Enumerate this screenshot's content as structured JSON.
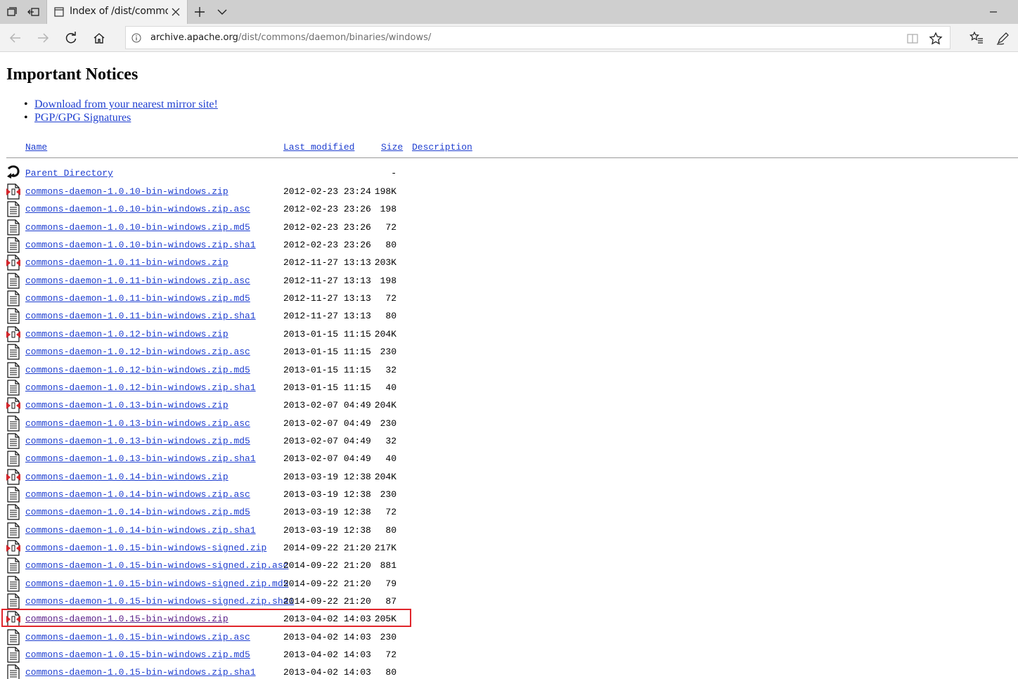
{
  "browser": {
    "tab_title": "Index of /dist/commons",
    "url_host": "archive.apache.org",
    "url_path": "/dist/commons/daemon/binaries/windows/"
  },
  "page": {
    "heading": "Important Notices",
    "notices": [
      {
        "label": "Download from your nearest mirror site!"
      },
      {
        "label": "PGP/GPG Signatures"
      }
    ],
    "columns": {
      "name": "Name",
      "last_modified": "Last modified",
      "size": "Size",
      "description": "Description"
    },
    "parent": {
      "label": "Parent Directory",
      "size": "-"
    },
    "files": [
      {
        "name": "commons-daemon-1.0.10-bin-windows.zip",
        "date": "2012-02-23 23:24",
        "size": "198K",
        "icon": "zip"
      },
      {
        "name": "commons-daemon-1.0.10-bin-windows.zip.asc",
        "date": "2012-02-23 23:26",
        "size": "198",
        "icon": "text"
      },
      {
        "name": "commons-daemon-1.0.10-bin-windows.zip.md5",
        "date": "2012-02-23 23:26",
        "size": "72",
        "icon": "text"
      },
      {
        "name": "commons-daemon-1.0.10-bin-windows.zip.sha1",
        "date": "2012-02-23 23:26",
        "size": "80",
        "icon": "text"
      },
      {
        "name": "commons-daemon-1.0.11-bin-windows.zip",
        "date": "2012-11-27 13:13",
        "size": "203K",
        "icon": "zip"
      },
      {
        "name": "commons-daemon-1.0.11-bin-windows.zip.asc",
        "date": "2012-11-27 13:13",
        "size": "198",
        "icon": "text"
      },
      {
        "name": "commons-daemon-1.0.11-bin-windows.zip.md5",
        "date": "2012-11-27 13:13",
        "size": "72",
        "icon": "text"
      },
      {
        "name": "commons-daemon-1.0.11-bin-windows.zip.sha1",
        "date": "2012-11-27 13:13",
        "size": "80",
        "icon": "text"
      },
      {
        "name": "commons-daemon-1.0.12-bin-windows.zip",
        "date": "2013-01-15 11:15",
        "size": "204K",
        "icon": "zip"
      },
      {
        "name": "commons-daemon-1.0.12-bin-windows.zip.asc",
        "date": "2013-01-15 11:15",
        "size": "230",
        "icon": "text"
      },
      {
        "name": "commons-daemon-1.0.12-bin-windows.zip.md5",
        "date": "2013-01-15 11:15",
        "size": "32",
        "icon": "text"
      },
      {
        "name": "commons-daemon-1.0.12-bin-windows.zip.sha1",
        "date": "2013-01-15 11:15",
        "size": "40",
        "icon": "text"
      },
      {
        "name": "commons-daemon-1.0.13-bin-windows.zip",
        "date": "2013-02-07 04:49",
        "size": "204K",
        "icon": "zip"
      },
      {
        "name": "commons-daemon-1.0.13-bin-windows.zip.asc",
        "date": "2013-02-07 04:49",
        "size": "230",
        "icon": "text"
      },
      {
        "name": "commons-daemon-1.0.13-bin-windows.zip.md5",
        "date": "2013-02-07 04:49",
        "size": "32",
        "icon": "text"
      },
      {
        "name": "commons-daemon-1.0.13-bin-windows.zip.sha1",
        "date": "2013-02-07 04:49",
        "size": "40",
        "icon": "text"
      },
      {
        "name": "commons-daemon-1.0.14-bin-windows.zip",
        "date": "2013-03-19 12:38",
        "size": "204K",
        "icon": "zip"
      },
      {
        "name": "commons-daemon-1.0.14-bin-windows.zip.asc",
        "date": "2013-03-19 12:38",
        "size": "230",
        "icon": "text"
      },
      {
        "name": "commons-daemon-1.0.14-bin-windows.zip.md5",
        "date": "2013-03-19 12:38",
        "size": "72",
        "icon": "text"
      },
      {
        "name": "commons-daemon-1.0.14-bin-windows.zip.sha1",
        "date": "2013-03-19 12:38",
        "size": "80",
        "icon": "text"
      },
      {
        "name": "commons-daemon-1.0.15-bin-windows-signed.zip",
        "date": "2014-09-22 21:20",
        "size": "217K",
        "icon": "zip"
      },
      {
        "name": "commons-daemon-1.0.15-bin-windows-signed.zip.asc",
        "date": "2014-09-22 21:20",
        "size": "881",
        "icon": "text"
      },
      {
        "name": "commons-daemon-1.0.15-bin-windows-signed.zip.md5",
        "date": "2014-09-22 21:20",
        "size": "79",
        "icon": "text"
      },
      {
        "name": "commons-daemon-1.0.15-bin-windows-signed.zip.sha1",
        "date": "2014-09-22 21:20",
        "size": "87",
        "icon": "text"
      },
      {
        "name": "commons-daemon-1.0.15-bin-windows.zip",
        "date": "2013-04-02 14:03",
        "size": "205K",
        "icon": "zip",
        "highlighted": true,
        "visited": true
      },
      {
        "name": "commons-daemon-1.0.15-bin-windows.zip.asc",
        "date": "2013-04-02 14:03",
        "size": "230",
        "icon": "text"
      },
      {
        "name": "commons-daemon-1.0.15-bin-windows.zip.md5",
        "date": "2013-04-02 14:03",
        "size": "72",
        "icon": "text"
      },
      {
        "name": "commons-daemon-1.0.15-bin-windows.zip.sha1",
        "date": "2013-04-02 14:03",
        "size": "80",
        "icon": "text"
      }
    ]
  },
  "colors": {
    "link": "#1f3fd0",
    "visited_link": "#5a1f8a",
    "highlight_border": "#e0252b",
    "chrome_bg": "#f2f2f2",
    "tabbar_bg": "#cfcfcf"
  }
}
